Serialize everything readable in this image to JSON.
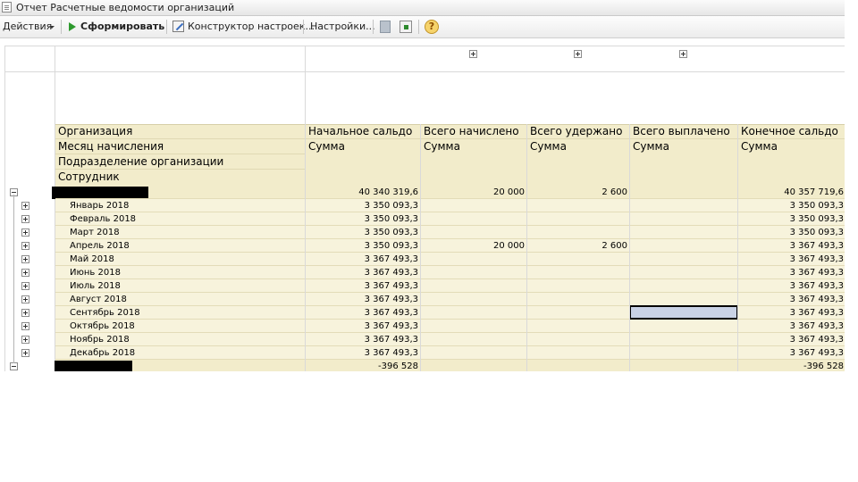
{
  "window": {
    "title": "Отчет  Расчетные ведомости организаций"
  },
  "toolbar": {
    "actions_label": "Действия",
    "generate_label": "Сформировать",
    "constructor_label": "Конструктор настроек...",
    "settings_label": "Настройки...",
    "help_glyph": "?"
  },
  "report": {
    "row_headers": [
      "Организация",
      "Месяц начисления",
      "Подразделение организации",
      "Сотрудник"
    ],
    "columns": [
      {
        "title": "Начальное сальдо",
        "sub": "Сумма"
      },
      {
        "title": "Всего начислено",
        "sub": "Сумма"
      },
      {
        "title": "Всего удержано",
        "sub": "Сумма"
      },
      {
        "title": "Всего выплачено",
        "sub": "Сумма"
      },
      {
        "title": "Конечное сальдо",
        "sub": "Сумма"
      }
    ],
    "org_total": {
      "values": [
        "40 340 319,6",
        "20 000",
        "2 600",
        "",
        "40 357 719,6"
      ]
    },
    "months": [
      {
        "name": "Январь 2018",
        "values": [
          "3 350 093,3",
          "",
          "",
          "",
          "3 350 093,3"
        ]
      },
      {
        "name": "Февраль 2018",
        "values": [
          "3 350 093,3",
          "",
          "",
          "",
          "3 350 093,3"
        ]
      },
      {
        "name": "Март 2018",
        "values": [
          "3 350 093,3",
          "",
          "",
          "",
          "3 350 093,3"
        ]
      },
      {
        "name": "Апрель 2018",
        "values": [
          "3 350 093,3",
          "20 000",
          "2 600",
          "",
          "3 367 493,3"
        ]
      },
      {
        "name": "Май 2018",
        "values": [
          "3 367 493,3",
          "",
          "",
          "",
          "3 367 493,3"
        ]
      },
      {
        "name": "Июнь 2018",
        "values": [
          "3 367 493,3",
          "",
          "",
          "",
          "3 367 493,3"
        ]
      },
      {
        "name": "Июль 2018",
        "values": [
          "3 367 493,3",
          "",
          "",
          "",
          "3 367 493,3"
        ]
      },
      {
        "name": "Август 2018",
        "values": [
          "3 367 493,3",
          "",
          "",
          "",
          "3 367 493,3"
        ]
      },
      {
        "name": "Сентябрь 2018",
        "values": [
          "3 367 493,3",
          "",
          "",
          "",
          "3 367 493,3"
        ]
      },
      {
        "name": "Октябрь 2018",
        "values": [
          "3 367 493,3",
          "",
          "",
          "",
          "3 367 493,3"
        ]
      },
      {
        "name": "Ноябрь 2018",
        "values": [
          "3 367 493,3",
          "",
          "",
          "",
          "3 367 493,3"
        ]
      },
      {
        "name": "Декабрь 2018",
        "values": [
          "3 367 493,3",
          "",
          "",
          "",
          "3 367 493,3"
        ]
      }
    ],
    "second_org": {
      "values": [
        "-396 528",
        "",
        "",
        "",
        "-396 528"
      ]
    }
  },
  "colors": {
    "header_bg": "#f2eccb",
    "row_bg": "#f7f3dc",
    "selection": "#c9d2e6",
    "generate_icon": "#2e9a2e"
  },
  "icons": [
    "report-icon",
    "dropdown-caret-icon",
    "play-icon",
    "constructor-icon",
    "export-icon",
    "save-icon",
    "help-icon",
    "expand-plus-icon",
    "collapse-minus-icon"
  ]
}
